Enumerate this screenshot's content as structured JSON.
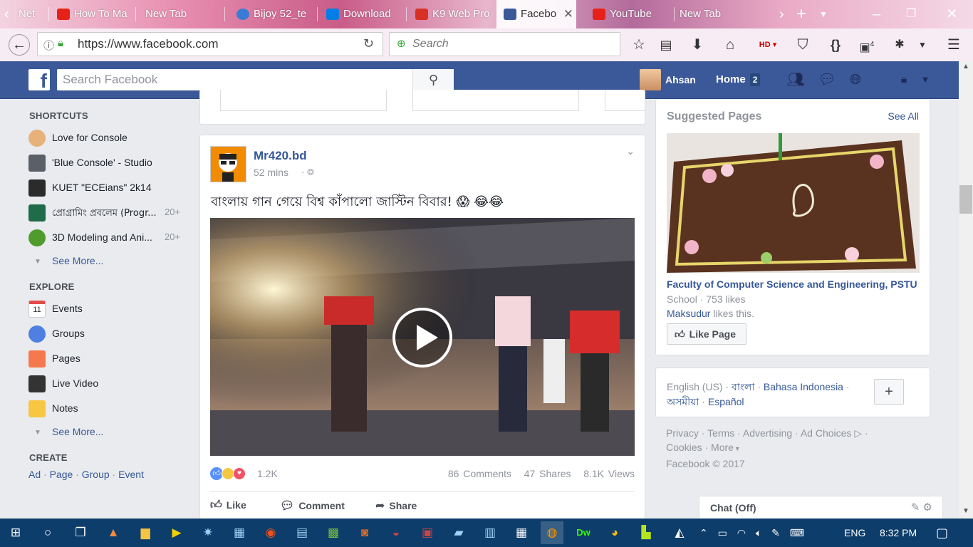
{
  "browser": {
    "tabs": [
      {
        "label": "Net",
        "icon": "page-icon",
        "color": "#888888",
        "active": false
      },
      {
        "label": "How To Ma",
        "icon": "youtube-icon",
        "color": "#e62117",
        "active": false
      },
      {
        "label": "New Tab",
        "icon": "none",
        "color": "",
        "active": false
      },
      {
        "label": "Bijoy 52_te",
        "icon": "cloud-icon",
        "color": "#3a7bd5",
        "active": false
      },
      {
        "label": "Download",
        "icon": "dropbox-icon",
        "color": "#007ee5",
        "active": false
      },
      {
        "label": "K9 Web Pro",
        "icon": "gmail-icon",
        "color": "#d93025",
        "active": false
      },
      {
        "label": "Facebo",
        "icon": "facebook-icon",
        "color": "#3b5998",
        "active": true
      },
      {
        "label": "YouTube",
        "icon": "youtube-icon",
        "color": "#e62117",
        "active": false
      },
      {
        "label": "New Tab",
        "icon": "none",
        "color": "",
        "active": false
      }
    ],
    "url": "https://www.facebook.com",
    "search_placeholder": "Search",
    "tab_overflow_count": "4"
  },
  "fb": {
    "search_placeholder": "Search Facebook",
    "user_name": "Ahsan",
    "home_label": "Home",
    "home_count": "2",
    "brand_color": "#3b5998"
  },
  "left": {
    "shortcuts_title": "SHORTCUTS",
    "shortcuts": [
      {
        "label": "Love for Console",
        "count": "",
        "icon": "rock-hand-icon"
      },
      {
        "label": "'Blue Console' - Studio",
        "count": "",
        "icon": "gamepad-icon"
      },
      {
        "label": "KUET \"ECEians\" 2k14",
        "count": "",
        "icon": "graduation-cap-icon"
      },
      {
        "label": "প্রোগ্রামিং প্রবলেম (Progr...",
        "count": "20+",
        "icon": "monitor-icon"
      },
      {
        "label": "3D Modeling and Ani...",
        "count": "20+",
        "icon": "tree-icon"
      }
    ],
    "see_more": "See More...",
    "explore_title": "EXPLORE",
    "explore": [
      {
        "label": "Events",
        "icon": "calendar-icon"
      },
      {
        "label": "Groups",
        "icon": "groups-icon"
      },
      {
        "label": "Pages",
        "icon": "flag-icon"
      },
      {
        "label": "Live Video",
        "icon": "live-video-icon"
      },
      {
        "label": "Notes",
        "icon": "notes-icon"
      }
    ],
    "see_more_2": "See More...",
    "create_title": "CREATE",
    "create_links": [
      "Ad",
      "Page",
      "Group",
      "Event"
    ]
  },
  "post": {
    "author": "Mr420.bd",
    "time": "52 mins",
    "text": "বাংলায় গান গেয়ে বিশ্ব কাঁপালো জাস্টিন বিবার! 😱 😂😂",
    "reactions_count": "1.2K",
    "comments": "86 Comments",
    "shares": "47 Shares",
    "views": "8.1K Views",
    "like_label": "Like",
    "comment_label": "Comment",
    "share_label": "Share"
  },
  "right": {
    "suggested_title": "Suggested Pages",
    "see_all": "See All",
    "page_name": "Faculty of Computer Science and Engineering, PSTU",
    "page_type": "School",
    "page_likes": "753 likes",
    "friend_name": "Maksudur",
    "friend_suffix": " likes this.",
    "like_page_label": "Like Page",
    "languages": {
      "current": "English (US)",
      "others": [
        "বাংলা",
        "Bahasa Indonesia",
        "অসমীয়া",
        "Español"
      ]
    },
    "footer_links": [
      "Privacy",
      "Terms",
      "Advertising",
      "Ad Choices",
      "Cookies",
      "More"
    ],
    "copyright": "Facebook © 2017",
    "chat_label": "Chat (Off)"
  },
  "taskbar": {
    "language": "ENG",
    "time": "8:32 PM"
  }
}
